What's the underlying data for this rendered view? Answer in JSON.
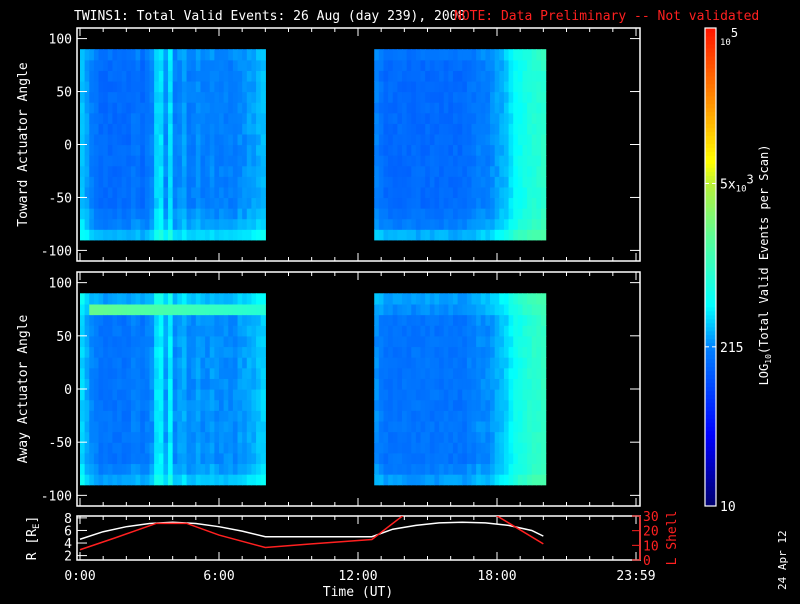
{
  "title": {
    "main": "TWINS1: Total Valid Events: 26 Aug (day 239), 2008",
    "note": "NOTE: Data Preliminary -- Not validated",
    "note_color": "#ff2020"
  },
  "date_stamp": "24 Apr 12",
  "chart_data": [
    {
      "type": "heatmap",
      "name": "toward",
      "ylabel": "Toward Actuator Angle",
      "ylim": [
        -110,
        110
      ],
      "yticks": [
        "100",
        "50",
        "0",
        "-50",
        "-100"
      ],
      "ytick_values": [
        100,
        50,
        0,
        -50,
        -100
      ],
      "angle_range": [
        -90,
        90
      ],
      "angle_bin_deg": 10,
      "time_bin_hours": 0.2,
      "blocks": [
        {
          "start_hour": 0.0,
          "log_values": [
            2.5,
            2.4,
            2.3,
            2.25,
            2.2,
            2.2,
            2.2,
            2.2,
            2.2,
            2.2,
            2.2,
            2.25,
            2.25,
            2.2,
            2.25,
            2.3,
            2.55,
            2.6,
            2.35,
            2.6,
            2.3,
            2.35,
            2.4,
            2.3,
            2.3,
            2.35,
            2.3,
            2.3,
            2.35,
            2.3,
            2.3,
            2.3,
            2.3,
            2.3,
            2.35,
            2.35,
            2.4,
            2.4,
            2.45,
            2.5
          ]
        },
        {
          "start_hour": 12.7,
          "log_values": [
            2.3,
            2.25,
            2.2,
            2.2,
            2.2,
            2.2,
            2.2,
            2.2,
            2.2,
            2.2,
            2.2,
            2.2,
            2.2,
            2.2,
            2.2,
            2.2,
            2.2,
            2.2,
            2.2,
            2.2,
            2.25,
            2.25,
            2.3,
            2.3,
            2.3,
            2.35,
            2.4,
            2.45,
            2.5,
            2.6,
            2.7,
            2.75,
            2.8,
            2.85,
            2.9,
            2.9,
            2.95
          ]
        }
      ],
      "row_offsets": [
        0.25,
        0.1,
        0.05,
        0,
        0,
        0,
        0,
        0,
        0,
        0,
        0,
        0,
        0,
        0,
        0,
        0,
        0,
        0.05
      ]
    },
    {
      "type": "heatmap",
      "name": "away",
      "ylabel": "Away Actuator Angle",
      "ylim": [
        -110,
        110
      ],
      "yticks": [
        "100",
        "50",
        "0",
        "-50",
        "-100"
      ],
      "ytick_values": [
        100,
        50,
        0,
        -50,
        -100
      ],
      "angle_range": [
        -90,
        90
      ],
      "angle_bin_deg": 10,
      "time_bin_hours": 0.2,
      "blocks": [
        {
          "start_hour": 0.0,
          "log_values": [
            2.55,
            2.45,
            2.35,
            2.3,
            2.25,
            2.25,
            2.25,
            2.25,
            2.25,
            2.25,
            2.25,
            2.3,
            2.3,
            2.25,
            2.3,
            2.35,
            2.6,
            2.65,
            2.4,
            2.65,
            2.35,
            2.4,
            2.45,
            2.35,
            2.35,
            2.4,
            2.35,
            2.35,
            2.4,
            2.35,
            2.35,
            2.35,
            2.35,
            2.35,
            2.4,
            2.4,
            2.45,
            2.45,
            2.5,
            2.55
          ]
        },
        {
          "start_hour": 12.7,
          "log_values": [
            2.35,
            2.3,
            2.25,
            2.25,
            2.25,
            2.25,
            2.25,
            2.25,
            2.25,
            2.25,
            2.25,
            2.25,
            2.25,
            2.25,
            2.25,
            2.25,
            2.25,
            2.25,
            2.25,
            2.25,
            2.3,
            2.3,
            2.35,
            2.35,
            2.35,
            2.4,
            2.45,
            2.5,
            2.55,
            2.65,
            2.75,
            2.8,
            2.85,
            2.9,
            2.95,
            2.95,
            3.0
          ]
        }
      ],
      "row_offsets": [
        0.15,
        0.05,
        0,
        0,
        0,
        0,
        0,
        0,
        0,
        0,
        0,
        0,
        0,
        0,
        0,
        0,
        0.1,
        0.15
      ],
      "band": {
        "angle_min": 70,
        "angle_max": 80,
        "start_hour": 0.4,
        "end_hour": 8.0,
        "peak_log": 3.3,
        "end_log": 2.9
      }
    },
    {
      "type": "line",
      "name": "orbit",
      "xlabel": "Time (UT)",
      "xticks": [
        "0:00",
        "6:00",
        "12:00",
        "18:00",
        "23:59"
      ],
      "xtick_hours": [
        0,
        6,
        12,
        18,
        24
      ],
      "xlim": [
        0,
        24
      ],
      "ylabel": "R [R",
      "ylabel_sub": "E",
      "ylabel_end": "]",
      "ylim": [
        1.3,
        8.3
      ],
      "yticks": [
        "8",
        "6",
        "4",
        "2"
      ],
      "ytick_values": [
        8,
        6,
        4,
        2
      ],
      "y2label": "L Shell",
      "y2lim": [
        0,
        30
      ],
      "y2ticks": [
        "30",
        "20",
        "10",
        "0"
      ],
      "y2tick_values": [
        30,
        20,
        10,
        0
      ],
      "series": [
        {
          "name": "R",
          "color": "#ffffff",
          "x": [
            0,
            1,
            2,
            3,
            4,
            5,
            6,
            7,
            8,
            10,
            12.6,
            13.5,
            14.5,
            15.5,
            16.5,
            17.5,
            18.5,
            19.5,
            20
          ],
          "y": [
            4.6,
            5.8,
            6.6,
            7.1,
            7.3,
            7.1,
            6.6,
            5.9,
            5.0,
            5.0,
            5.0,
            6.2,
            6.8,
            7.2,
            7.3,
            7.2,
            6.8,
            6.0,
            5.1
          ]
        },
        {
          "name": "L Shell",
          "color": "#ff2020",
          "x": [
            0,
            1.5,
            3.3,
            4.6,
            6,
            8,
            10,
            12.6,
            14.0,
            17.9,
            20
          ],
          "y": [
            7,
            15,
            25,
            25,
            17,
            8.5,
            11,
            14,
            31,
            31,
            11
          ]
        }
      ]
    },
    {
      "type": "colorbar",
      "label": "LOG",
      "label_sub": "10",
      "label_end": "(Total Valid Events per Scan)",
      "range_log": [
        1,
        5
      ],
      "ticks": [
        {
          "log": 1,
          "text": "10"
        },
        {
          "log": 2.332,
          "text": "215"
        },
        {
          "log": 3.699,
          "text": "5x",
          "sub": "10",
          "sup": "3"
        },
        {
          "log": 5,
          "text": "",
          "sub": "10",
          "sup": "5"
        }
      ]
    }
  ]
}
